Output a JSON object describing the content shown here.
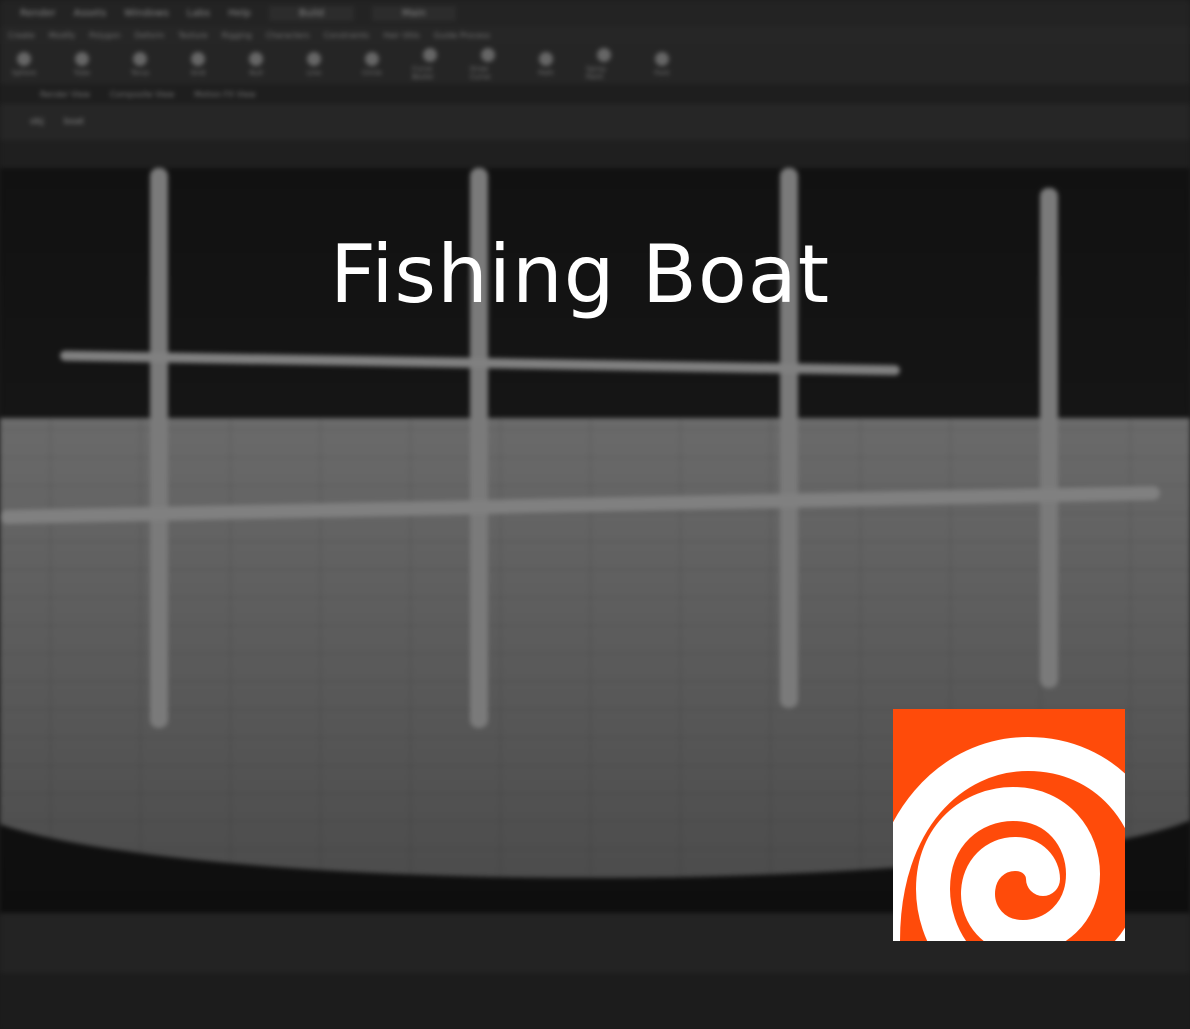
{
  "menu": [
    "Render",
    "Assets",
    "Windows",
    "Labs",
    "Help"
  ],
  "desktops": [
    "Build",
    "Main"
  ],
  "shelf_tabs": [
    "Create",
    "Modify",
    "Polygon",
    "Deform",
    "Texture",
    "Rigging",
    "Characters",
    "Constraints",
    "Hair Utils",
    "Guide Process"
  ],
  "tools": [
    "Sphere",
    "Tube",
    "Torus",
    "Grid",
    "Null",
    "Line",
    "Circle",
    "Curve Bezier",
    "Draw Curve",
    "Path",
    "Spray Paint",
    "Font"
  ],
  "pane_tabs": [
    "Render View",
    "Composite View",
    "Motion FX View"
  ],
  "path": [
    "obj",
    "boat"
  ],
  "title": "Fishing Boat",
  "colors": {
    "logo": "#ff4b0a"
  }
}
